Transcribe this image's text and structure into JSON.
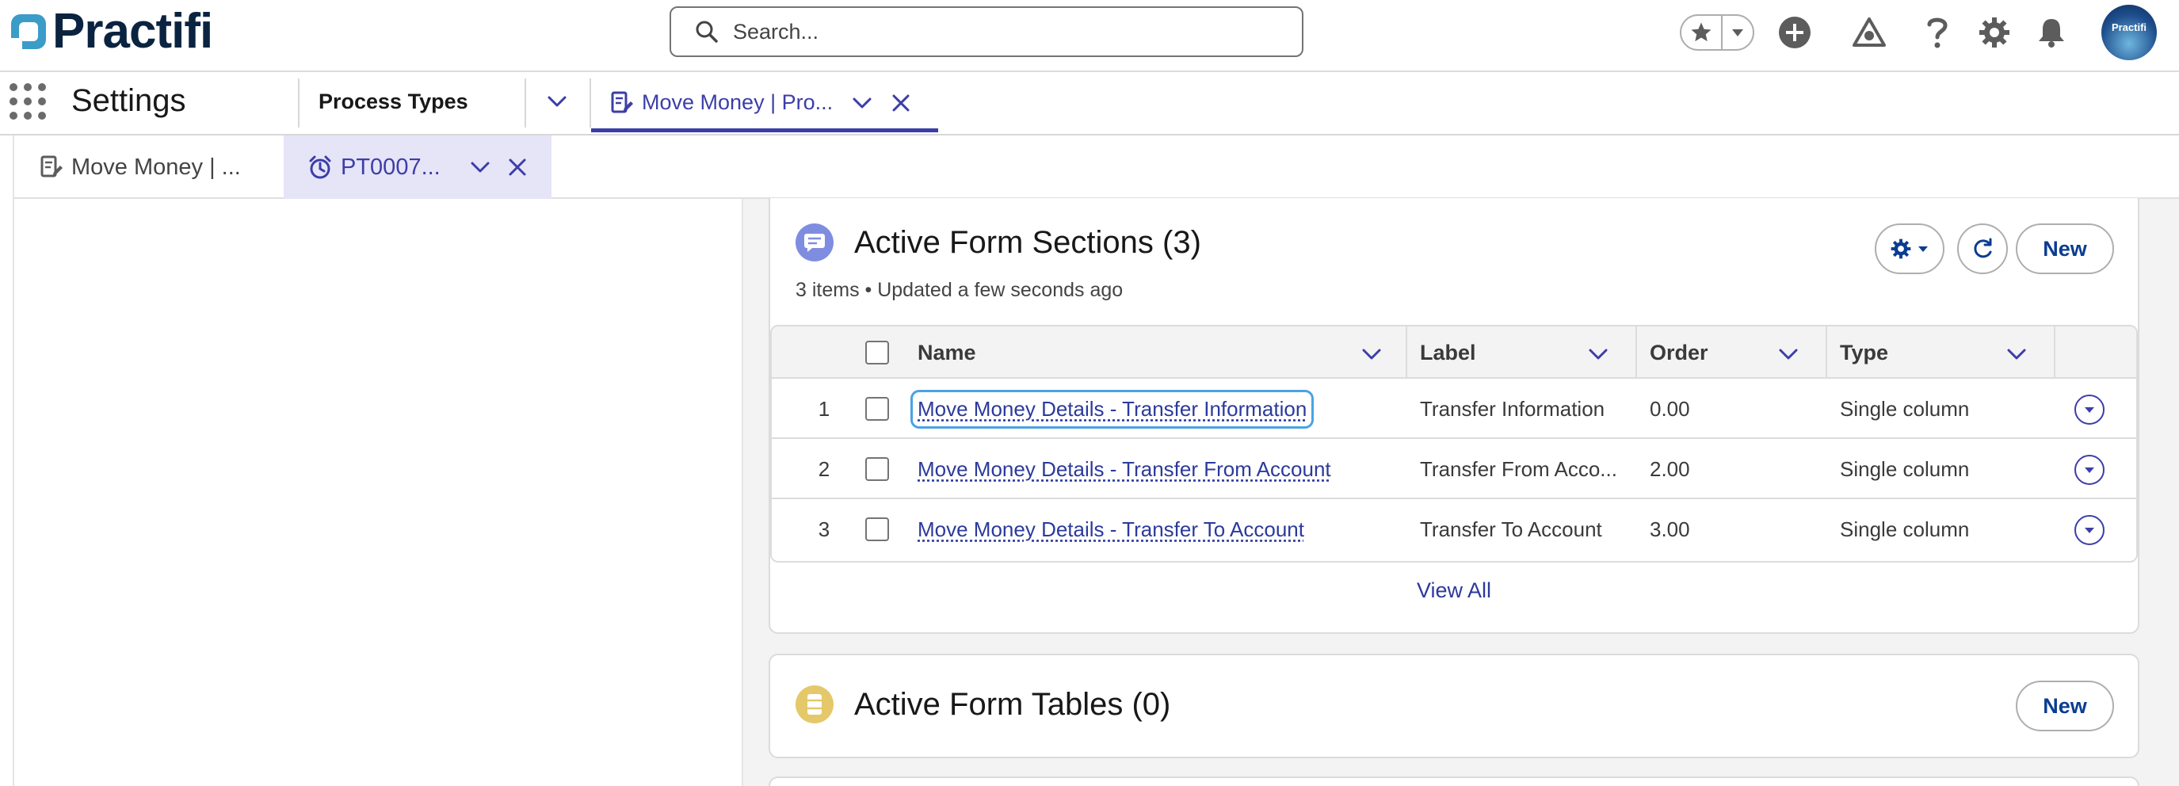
{
  "header": {
    "logo_text": "Practifi",
    "search_placeholder": "Search...",
    "avatar_text": "Practifi"
  },
  "nav": {
    "app_name": "Settings",
    "item": "Process Types",
    "active_tab": "Move Money | Pro..."
  },
  "subtabs": [
    {
      "label": "Move Money | ..."
    },
    {
      "label": "PT0007..."
    }
  ],
  "sections_card": {
    "title": "Active Form Sections (3)",
    "meta": "3 items • Updated a few seconds ago",
    "new_label": "New",
    "columns": [
      "Name",
      "Label",
      "Order",
      "Type"
    ],
    "rows": [
      {
        "num": "1",
        "name": "Move Money Details - Transfer Information",
        "label": "Transfer Information",
        "order": "0.00",
        "type": "Single column"
      },
      {
        "num": "2",
        "name": "Move Money Details - Transfer From Account",
        "label": "Transfer From Acco...",
        "order": "2.00",
        "type": "Single column"
      },
      {
        "num": "3",
        "name": "Move Money Details - Transfer To Account",
        "label": "Transfer To Account",
        "order": "3.00",
        "type": "Single column"
      }
    ],
    "view_all": "View All"
  },
  "tables_card": {
    "title": "Active Form Tables (0)",
    "new_label": "New"
  },
  "colors": {
    "brand": "#0a2340",
    "accent": "#3c3ea8",
    "link": "#2b3a9c",
    "sections_icon": "#7f8de1",
    "tables_icon": "#e4c86a"
  }
}
